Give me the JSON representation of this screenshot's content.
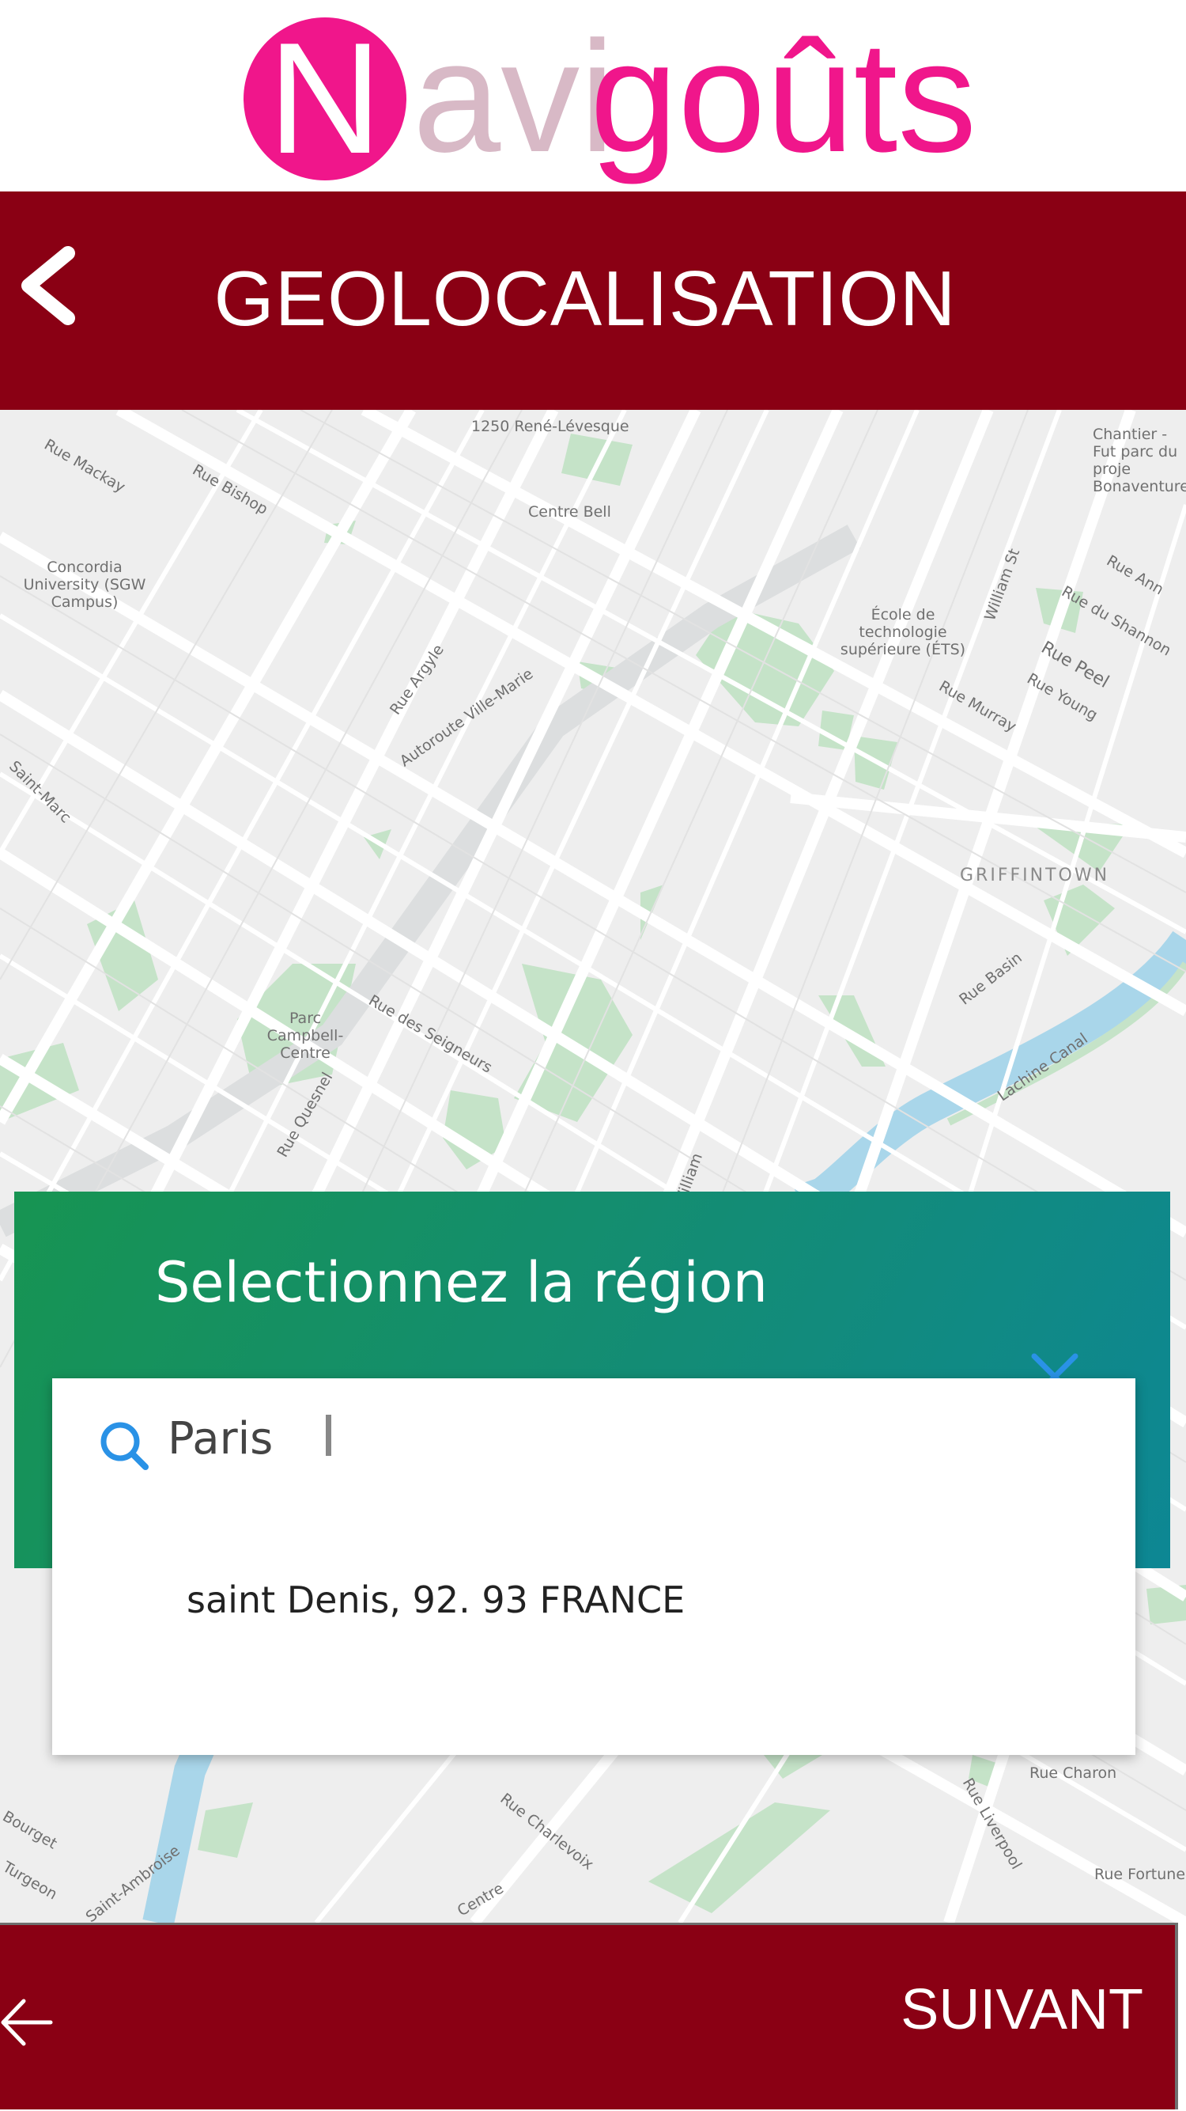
{
  "app": {
    "logo": {
      "initial": "N",
      "part2": "avi",
      "part3": "goûts"
    }
  },
  "header": {
    "title": "GEOLOCALISATION",
    "back_icon": "chevron-left-icon"
  },
  "map": {
    "labels": [
      "1250 René-Lévesque",
      "Chantier - Fut parc du proje Bonaventure",
      "Rue Mackay",
      "Rue Bishop",
      "Centre Bell",
      "Concordia University (SGW Campus)",
      "William St",
      "Rue Ann",
      "Rue du Shannon",
      "École de technologie supérieure (ÉTS)",
      "Rue Peel",
      "Rue Young",
      "Rue Murray",
      "Rue Argyle",
      "Autoroute Ville-Marie",
      "Saint-Marc",
      "GRIFFINTOWN",
      "Rue Basin",
      "Parc Campbell-Centre",
      "Rue des Seigneurs",
      "Lachine Canal",
      "Rue Quesnel",
      "Rue Charon",
      "Rue Charlevoix",
      "Rue Liverpool",
      "Rue Fortune",
      "Bourget",
      "Turgeon",
      "Saint-Ambroise",
      "Centre",
      "William"
    ]
  },
  "dialog": {
    "title": "Selectionnez la région",
    "close_icon": "close-icon",
    "search": {
      "value": "Paris",
      "icon": "search-icon"
    },
    "suggestions": [
      "saint Denis, 92. 93 FRANCE"
    ]
  },
  "footer": {
    "back_icon": "arrow-left-icon",
    "next_label": "SUIVANT"
  },
  "colors": {
    "header_bg": "#8a0014",
    "logo_pink": "#f0168b",
    "logo_light": "#d8b9c6",
    "dialog_green": "#179452",
    "dialog_teal": "#0d8794",
    "accent_blue": "#2a92e6",
    "park_green": "#c5e3c8",
    "water_blue": "#a9d6ea"
  }
}
